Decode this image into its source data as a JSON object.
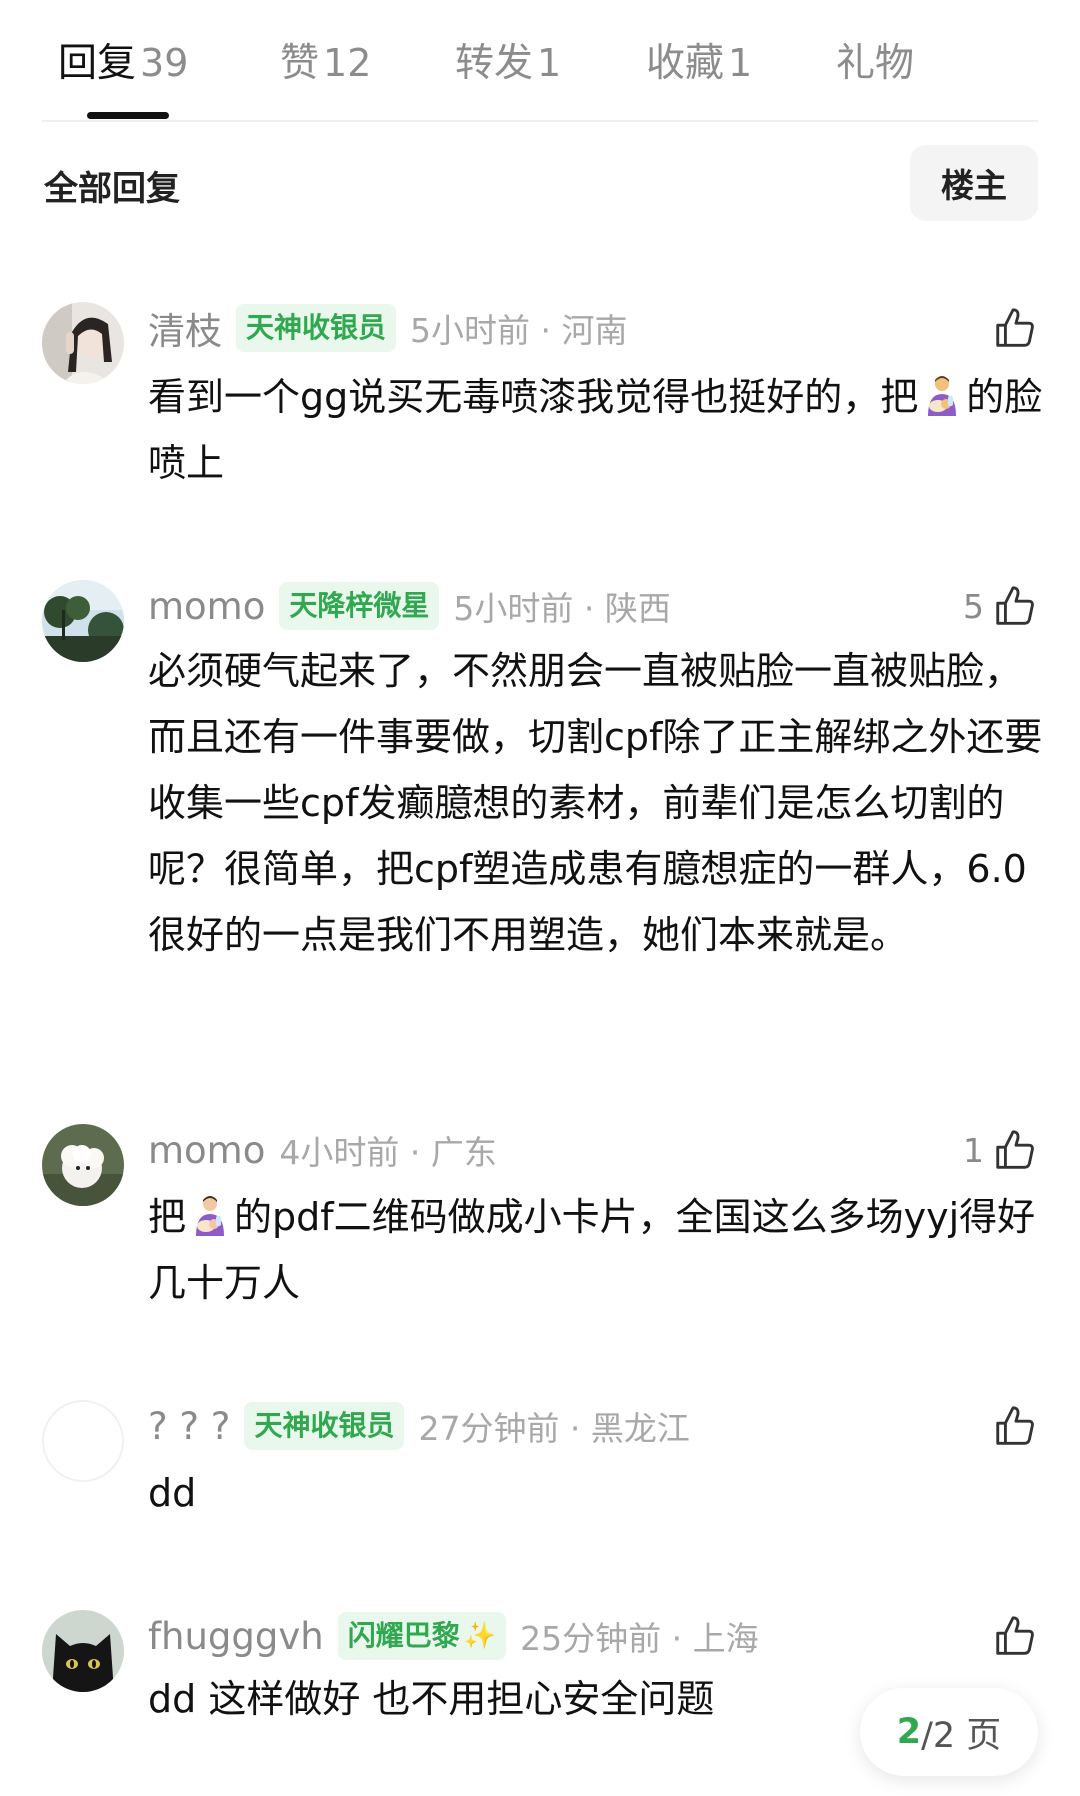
{
  "tabs": [
    {
      "label": "回复",
      "count": "39"
    },
    {
      "label": "赞",
      "count": "12"
    },
    {
      "label": "转发",
      "count": "1"
    },
    {
      "label": "收藏",
      "count": "1"
    },
    {
      "label": "礼物",
      "count": ""
    }
  ],
  "section": {
    "title": "全部回复",
    "owner_button": "楼主"
  },
  "comments": [
    {
      "username": "清枝",
      "badge": "天神收银员",
      "time": "5小时前 · 河南",
      "likes": "",
      "text_a": "看到一个gg说买无毒喷漆我觉得也挺好的，把",
      "emoji": "man-feeding-baby-emoji",
      "text_b": "的脸喷上"
    },
    {
      "username": "momo",
      "badge": "天降梓微星",
      "time": "5小时前 · 陕西",
      "likes": "5",
      "text": "必须硬气起来了，不然朋会一直被贴脸一直被贴脸，而且还有一件事要做，切割cpf除了正主解绑之外还要收集一些cpf发癫臆想的素材，前辈们是怎么切割的呢？很简单，把cpf塑造成患有臆想症的一群人，6.0很好的一点是我们不用塑造，她们本来就是。"
    },
    {
      "username": "momo",
      "badge": "",
      "time": "4小时前 · 广东",
      "likes": "1",
      "text_a": "把",
      "emoji": "man-feeding-baby-emoji",
      "text_b": "的pdf二维码做成小卡片，全国这么多场yyj得好几十万人"
    },
    {
      "username": "? ? ?",
      "badge": "天神收银员",
      "time": "27分钟前 · 黑龙江",
      "likes": "",
      "text": "dd"
    },
    {
      "username": "fhugggvh",
      "badge": "闪耀巴黎",
      "badge_icon": "sparkles-emoji",
      "time": "25分钟前 · 上海",
      "likes": "",
      "text": "dd 这样做好 也不用担心安全问题"
    }
  ],
  "pager": {
    "current": "2",
    "rest": "/2 页"
  },
  "colors": {
    "accent_green": "#2fa84f",
    "badge_bg": "#e9f7ec",
    "muted_text": "#8a8a8a"
  }
}
